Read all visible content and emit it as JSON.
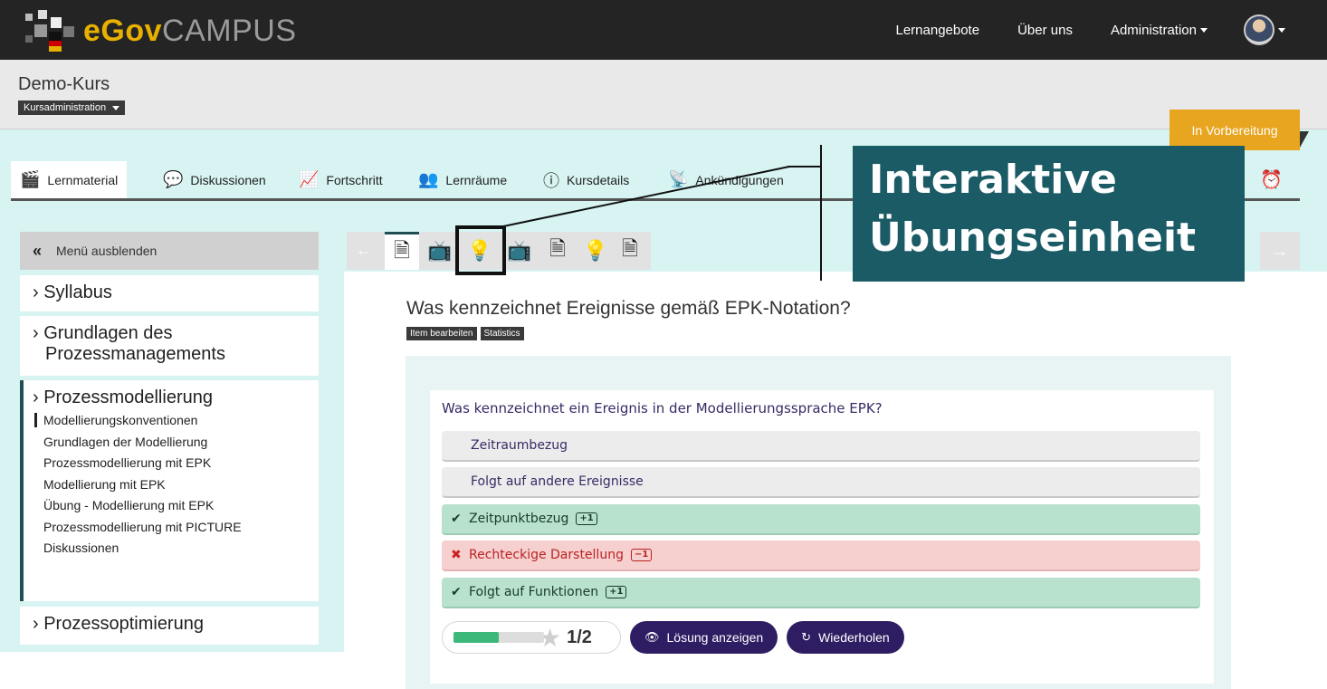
{
  "brand": {
    "logo_bold": "eGov",
    "logo_light": "CAMPUS"
  },
  "topnav": {
    "item1": "Lernangebote",
    "item2": "Über uns",
    "item3": "Administration"
  },
  "course": {
    "title": "Demo-Kurs",
    "admin_menu": "Kursadministration",
    "status": "In Vorbereitung"
  },
  "tabs": {
    "lernmaterial": "Lernmaterial",
    "diskussionen": "Diskussionen",
    "fortschritt": "Fortschritt",
    "lernraeume": "Lernräume",
    "kursdetails": "Kursdetails",
    "ankuendigungen": "Ankündigungen"
  },
  "sidebar": {
    "hide_label": "Menü ausblenden",
    "sections": [
      {
        "title": "› Syllabus"
      },
      {
        "title_line1": "› Grundlagen des",
        "title_line2": "Prozessmanagements"
      },
      {
        "title": "› Prozessmodellierung",
        "items": [
          "Modellierungskonventionen",
          "Grundlagen der Modellierung",
          "Prozessmodellierung mit EPK",
          "Modellierung mit EPK",
          "Übung - Modellierung mit EPK",
          "Prozessmodellierung mit PICTURE",
          "Diskussionen"
        ]
      },
      {
        "title": "› Prozessoptimierung"
      }
    ]
  },
  "itemnav": {
    "icons": [
      "document-icon",
      "video-icon",
      "quiz-icon",
      "video-icon",
      "document-icon",
      "quiz-icon",
      "document-icon"
    ]
  },
  "callout": {
    "line1": "Interaktive",
    "line2": "Übungseinheit"
  },
  "main": {
    "title": "Was kennzeichnet Ereignisse gemäß EPK-Notation?",
    "tag_edit": "Item bearbeiten",
    "tag_stats": "Statistics"
  },
  "quiz": {
    "question": "Was kennzeichnet ein Ereignis in der Modellierungssprache EPK?",
    "answers": [
      {
        "label": "Zeitraumbezug",
        "state": "neutral"
      },
      {
        "label": "Folgt auf andere Ereignisse",
        "state": "neutral"
      },
      {
        "label": "Zeitpunktbezug",
        "state": "correct",
        "score": "+1"
      },
      {
        "label": "Rechteckige Darstellung",
        "state": "wrong",
        "score": "−1"
      },
      {
        "label": "Folgt auf Funktionen",
        "state": "correct",
        "score": "+1"
      }
    ],
    "progress": 0.5,
    "score_text": "1/2",
    "show_solution": "Lösung anzeigen",
    "retry": "Wiederholen"
  },
  "colors": {
    "accent": "#1b5b66",
    "status": "#e8a520",
    "button": "#2e1d63",
    "correct": "#b8e2cd",
    "wrong": "#f6cfcf"
  }
}
